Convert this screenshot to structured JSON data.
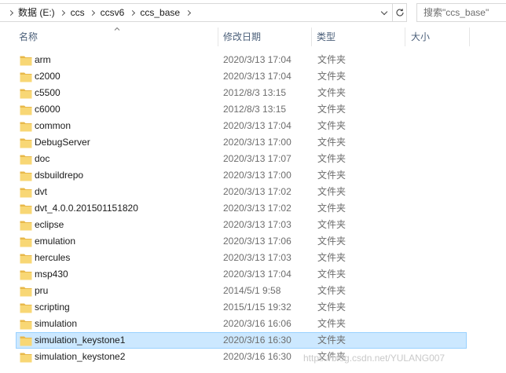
{
  "address": {
    "breadcrumbs": [
      "数据 (E:)",
      "ccs",
      "ccsv6",
      "ccs_base"
    ]
  },
  "search": {
    "placeholder": "搜索\"ccs_base\""
  },
  "columns": {
    "name": "名称",
    "date": "修改日期",
    "type": "类型",
    "size": "大小"
  },
  "files": [
    {
      "name": "arm",
      "date": "2020/3/13 17:04",
      "type": "文件夹"
    },
    {
      "name": "c2000",
      "date": "2020/3/13 17:04",
      "type": "文件夹"
    },
    {
      "name": "c5500",
      "date": "2012/8/3 13:15",
      "type": "文件夹"
    },
    {
      "name": "c6000",
      "date": "2012/8/3 13:15",
      "type": "文件夹"
    },
    {
      "name": "common",
      "date": "2020/3/13 17:04",
      "type": "文件夹"
    },
    {
      "name": "DebugServer",
      "date": "2020/3/13 17:00",
      "type": "文件夹"
    },
    {
      "name": "doc",
      "date": "2020/3/13 17:07",
      "type": "文件夹"
    },
    {
      "name": "dsbuildrepo",
      "date": "2020/3/13 17:00",
      "type": "文件夹"
    },
    {
      "name": "dvt",
      "date": "2020/3/13 17:02",
      "type": "文件夹"
    },
    {
      "name": "dvt_4.0.0.201501151820",
      "date": "2020/3/13 17:02",
      "type": "文件夹"
    },
    {
      "name": "eclipse",
      "date": "2020/3/13 17:03",
      "type": "文件夹"
    },
    {
      "name": "emulation",
      "date": "2020/3/13 17:06",
      "type": "文件夹"
    },
    {
      "name": "hercules",
      "date": "2020/3/13 17:03",
      "type": "文件夹"
    },
    {
      "name": "msp430",
      "date": "2020/3/13 17:04",
      "type": "文件夹"
    },
    {
      "name": "pru",
      "date": "2014/5/1 9:58",
      "type": "文件夹"
    },
    {
      "name": "scripting",
      "date": "2015/1/15 19:32",
      "type": "文件夹"
    },
    {
      "name": "simulation",
      "date": "2020/3/16 16:06",
      "type": "文件夹"
    },
    {
      "name": "simulation_keystone1",
      "date": "2020/3/16 16:30",
      "type": "文件夹",
      "selected": true
    },
    {
      "name": "simulation_keystone2",
      "date": "2020/3/16 16:30",
      "type": "文件夹"
    }
  ],
  "watermark": "https://blog.csdn.net/YULANG007",
  "colors": {
    "folder": "#f8d775",
    "folder_dark": "#e8b84a",
    "selection_bg": "#cce8ff",
    "selection_border": "#99d1ff",
    "header_text": "#4c607a"
  },
  "icons": {
    "folder": "folder-icon",
    "separator": "chevron-right-icon",
    "dropdown": "chevron-down-icon",
    "refresh": "refresh-icon",
    "sort": "sort-ascending-icon"
  }
}
